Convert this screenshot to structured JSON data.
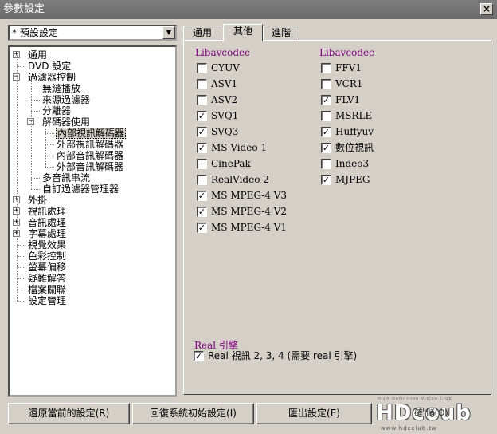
{
  "window": {
    "title": "參數設定",
    "close_label": "×"
  },
  "preset": {
    "value": "* 預設設定",
    "arrow": "▼"
  },
  "tree": {
    "items": [
      {
        "label": "通用",
        "expander": "+"
      },
      {
        "label": "DVD 設定"
      },
      {
        "label": "過濾器控制",
        "expander": "−"
      },
      {
        "label": "無縫播放"
      },
      {
        "label": "來源過濾器"
      },
      {
        "label": "分離器"
      },
      {
        "label": "解碼器使用",
        "expander": "−"
      },
      {
        "label": "內部視訊解碼器",
        "selected": true
      },
      {
        "label": "外部視訊解碼器"
      },
      {
        "label": "內部音訊解碼器"
      },
      {
        "label": "外部音訊解碼器"
      },
      {
        "label": "多音訊串流"
      },
      {
        "label": "自訂過濾器管理器"
      },
      {
        "label": "外掛",
        "expander": "+"
      },
      {
        "label": "視訊處理",
        "expander": "+"
      },
      {
        "label": "音訊處理",
        "expander": "+"
      },
      {
        "label": "字幕處理",
        "expander": "+"
      },
      {
        "label": "視覺效果"
      },
      {
        "label": "色彩控制"
      },
      {
        "label": "螢幕偏移"
      },
      {
        "label": "疑難解答"
      },
      {
        "label": "檔案關聯"
      },
      {
        "label": "設定管理"
      }
    ]
  },
  "tabs": [
    {
      "label": "通用",
      "active": false
    },
    {
      "label": "其他",
      "active": true
    },
    {
      "label": "進階",
      "active": false
    }
  ],
  "columns": [
    {
      "title": "Libavcodec",
      "items": [
        {
          "label": "CYUV",
          "checked": false
        },
        {
          "label": "ASV1",
          "checked": false
        },
        {
          "label": "ASV2",
          "checked": false
        },
        {
          "label": "SVQ1",
          "checked": true
        },
        {
          "label": "SVQ3",
          "checked": true
        },
        {
          "label": "MS Video 1",
          "checked": true
        },
        {
          "label": "CinePak",
          "checked": false
        },
        {
          "label": "RealVideo 2",
          "checked": false
        },
        {
          "label": "MS MPEG-4 V3",
          "checked": true
        },
        {
          "label": "MS MPEG-4 V2",
          "checked": true
        },
        {
          "label": "MS MPEG-4 V1",
          "checked": true
        }
      ]
    },
    {
      "title": "Libavcodec",
      "items": [
        {
          "label": "FFV1",
          "checked": false
        },
        {
          "label": "VCR1",
          "checked": false
        },
        {
          "label": "FLV1",
          "checked": true
        },
        {
          "label": "MSRLE",
          "checked": false
        },
        {
          "label": "Huffyuv",
          "checked": true
        },
        {
          "label": "數位視訊",
          "checked": true
        },
        {
          "label": "Indeo3",
          "checked": false
        },
        {
          "label": "MJPEG",
          "checked": true
        }
      ]
    }
  ],
  "real_engine": {
    "title": "Real 引擎",
    "option": {
      "label": "Real 視訊 2, 3, 4 (需要 real 引擎)",
      "checked": true
    }
  },
  "buttons": {
    "restore": "還原當前的設定(R)",
    "reset": "回復系統初始設定(I)",
    "export": "匯出設定(E)"
  },
  "watermark": {
    "logo": "HDcoub",
    "tagline": "High Definition Vision Club",
    "url": "www.hdcclub.tw",
    "overlay": "確 儲(O)"
  },
  "check_glyph": "✓"
}
